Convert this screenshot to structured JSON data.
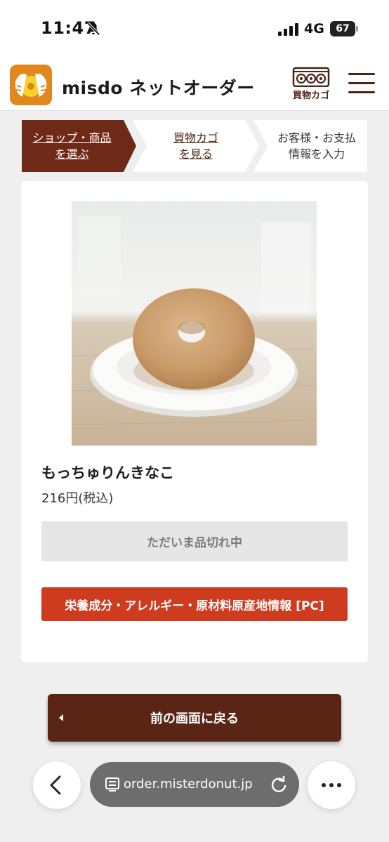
{
  "status": {
    "time": "11:47",
    "network": "4G",
    "battery": "67"
  },
  "header": {
    "brand": "misdo ネットオーダー",
    "cart_label": "買物カゴ",
    "colors": {
      "brand_brown": "#4b2214",
      "logo_orange": "#e2871e"
    }
  },
  "steps": [
    {
      "line1": "ショップ・商品",
      "line2": "を選ぶ",
      "active": true
    },
    {
      "line1": "買物カゴ",
      "line2": "を見る",
      "active": false
    },
    {
      "line1": "お客様・お支払",
      "line2": "情報を入力",
      "active": false
    }
  ],
  "product": {
    "name": "もっちゅりんきなこ",
    "price": "216円(税込)",
    "soldout_label": "ただいま品切れ中",
    "nutrition_button": "栄養成分・アレルギー・原材料原産地情報 [PC]"
  },
  "back_button": {
    "label": "前の画面に戻る"
  },
  "browser": {
    "url": "order.misterdonut.jp"
  },
  "icons": [
    "bell-slash-icon",
    "signal-icon",
    "logo-icon",
    "cart-icon",
    "menu-icon",
    "back-arrow-icon",
    "tabs-icon",
    "reload-icon",
    "more-icon"
  ]
}
